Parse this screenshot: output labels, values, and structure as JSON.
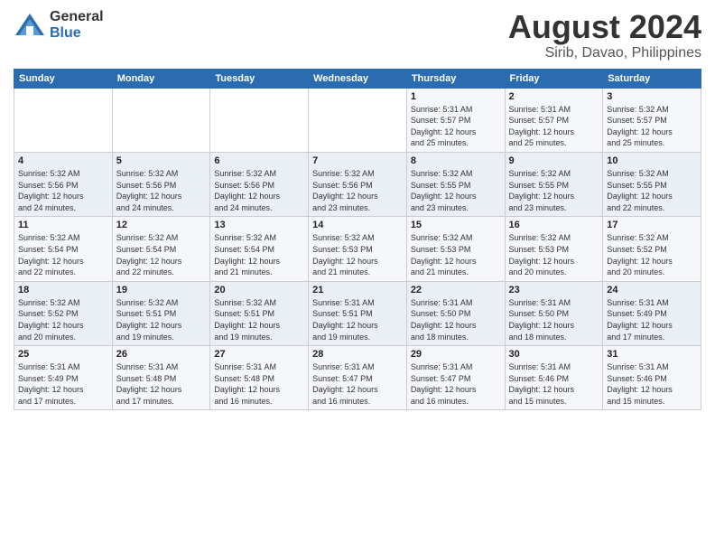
{
  "header": {
    "logo": {
      "general": "General",
      "blue": "Blue"
    },
    "title": "August 2024",
    "location": "Sirib, Davao, Philippines"
  },
  "weekdays": [
    "Sunday",
    "Monday",
    "Tuesday",
    "Wednesday",
    "Thursday",
    "Friday",
    "Saturday"
  ],
  "weeks": [
    [
      {
        "day": "",
        "info": ""
      },
      {
        "day": "",
        "info": ""
      },
      {
        "day": "",
        "info": ""
      },
      {
        "day": "",
        "info": ""
      },
      {
        "day": "1",
        "info": "Sunrise: 5:31 AM\nSunset: 5:57 PM\nDaylight: 12 hours\nand 25 minutes."
      },
      {
        "day": "2",
        "info": "Sunrise: 5:31 AM\nSunset: 5:57 PM\nDaylight: 12 hours\nand 25 minutes."
      },
      {
        "day": "3",
        "info": "Sunrise: 5:32 AM\nSunset: 5:57 PM\nDaylight: 12 hours\nand 25 minutes."
      }
    ],
    [
      {
        "day": "4",
        "info": "Sunrise: 5:32 AM\nSunset: 5:56 PM\nDaylight: 12 hours\nand 24 minutes."
      },
      {
        "day": "5",
        "info": "Sunrise: 5:32 AM\nSunset: 5:56 PM\nDaylight: 12 hours\nand 24 minutes."
      },
      {
        "day": "6",
        "info": "Sunrise: 5:32 AM\nSunset: 5:56 PM\nDaylight: 12 hours\nand 24 minutes."
      },
      {
        "day": "7",
        "info": "Sunrise: 5:32 AM\nSunset: 5:56 PM\nDaylight: 12 hours\nand 23 minutes."
      },
      {
        "day": "8",
        "info": "Sunrise: 5:32 AM\nSunset: 5:55 PM\nDaylight: 12 hours\nand 23 minutes."
      },
      {
        "day": "9",
        "info": "Sunrise: 5:32 AM\nSunset: 5:55 PM\nDaylight: 12 hours\nand 23 minutes."
      },
      {
        "day": "10",
        "info": "Sunrise: 5:32 AM\nSunset: 5:55 PM\nDaylight: 12 hours\nand 22 minutes."
      }
    ],
    [
      {
        "day": "11",
        "info": "Sunrise: 5:32 AM\nSunset: 5:54 PM\nDaylight: 12 hours\nand 22 minutes."
      },
      {
        "day": "12",
        "info": "Sunrise: 5:32 AM\nSunset: 5:54 PM\nDaylight: 12 hours\nand 22 minutes."
      },
      {
        "day": "13",
        "info": "Sunrise: 5:32 AM\nSunset: 5:54 PM\nDaylight: 12 hours\nand 21 minutes."
      },
      {
        "day": "14",
        "info": "Sunrise: 5:32 AM\nSunset: 5:53 PM\nDaylight: 12 hours\nand 21 minutes."
      },
      {
        "day": "15",
        "info": "Sunrise: 5:32 AM\nSunset: 5:53 PM\nDaylight: 12 hours\nand 21 minutes."
      },
      {
        "day": "16",
        "info": "Sunrise: 5:32 AM\nSunset: 5:53 PM\nDaylight: 12 hours\nand 20 minutes."
      },
      {
        "day": "17",
        "info": "Sunrise: 5:32 AM\nSunset: 5:52 PM\nDaylight: 12 hours\nand 20 minutes."
      }
    ],
    [
      {
        "day": "18",
        "info": "Sunrise: 5:32 AM\nSunset: 5:52 PM\nDaylight: 12 hours\nand 20 minutes."
      },
      {
        "day": "19",
        "info": "Sunrise: 5:32 AM\nSunset: 5:51 PM\nDaylight: 12 hours\nand 19 minutes."
      },
      {
        "day": "20",
        "info": "Sunrise: 5:32 AM\nSunset: 5:51 PM\nDaylight: 12 hours\nand 19 minutes."
      },
      {
        "day": "21",
        "info": "Sunrise: 5:31 AM\nSunset: 5:51 PM\nDaylight: 12 hours\nand 19 minutes."
      },
      {
        "day": "22",
        "info": "Sunrise: 5:31 AM\nSunset: 5:50 PM\nDaylight: 12 hours\nand 18 minutes."
      },
      {
        "day": "23",
        "info": "Sunrise: 5:31 AM\nSunset: 5:50 PM\nDaylight: 12 hours\nand 18 minutes."
      },
      {
        "day": "24",
        "info": "Sunrise: 5:31 AM\nSunset: 5:49 PM\nDaylight: 12 hours\nand 17 minutes."
      }
    ],
    [
      {
        "day": "25",
        "info": "Sunrise: 5:31 AM\nSunset: 5:49 PM\nDaylight: 12 hours\nand 17 minutes."
      },
      {
        "day": "26",
        "info": "Sunrise: 5:31 AM\nSunset: 5:48 PM\nDaylight: 12 hours\nand 17 minutes."
      },
      {
        "day": "27",
        "info": "Sunrise: 5:31 AM\nSunset: 5:48 PM\nDaylight: 12 hours\nand 16 minutes."
      },
      {
        "day": "28",
        "info": "Sunrise: 5:31 AM\nSunset: 5:47 PM\nDaylight: 12 hours\nand 16 minutes."
      },
      {
        "day": "29",
        "info": "Sunrise: 5:31 AM\nSunset: 5:47 PM\nDaylight: 12 hours\nand 16 minutes."
      },
      {
        "day": "30",
        "info": "Sunrise: 5:31 AM\nSunset: 5:46 PM\nDaylight: 12 hours\nand 15 minutes."
      },
      {
        "day": "31",
        "info": "Sunrise: 5:31 AM\nSunset: 5:46 PM\nDaylight: 12 hours\nand 15 minutes."
      }
    ]
  ]
}
